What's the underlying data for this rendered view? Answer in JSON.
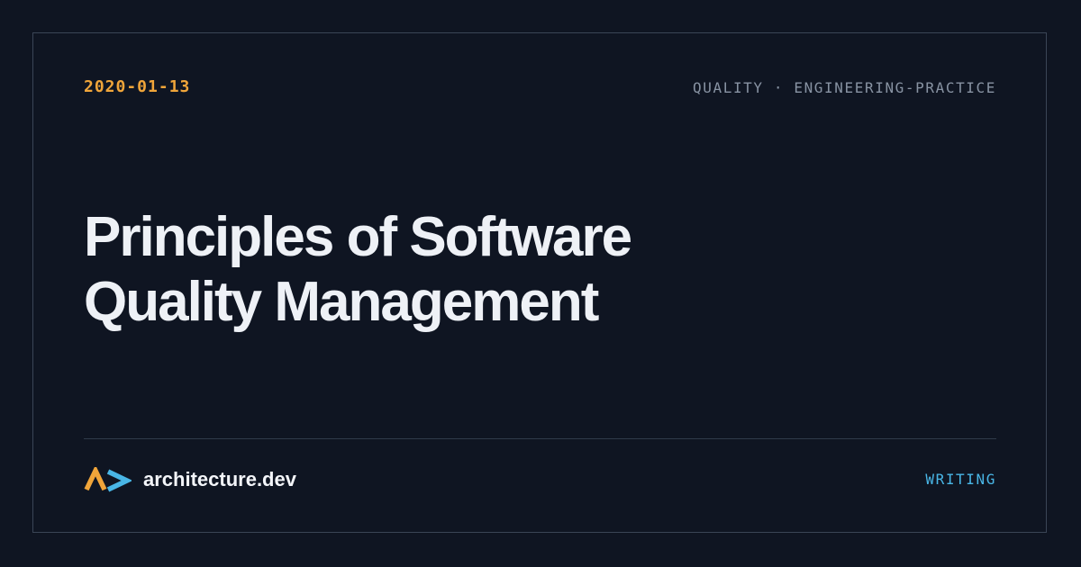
{
  "post": {
    "date": "2020-01-13",
    "tags": "QUALITY · ENGINEERING-PRACTICE",
    "title_line1": "Principles of Software",
    "title_line2": "Quality Management"
  },
  "footer": {
    "brand_name": "architecture.dev",
    "section": "WRITING",
    "logo_icon": "architecture-logo-icon"
  },
  "colors": {
    "background": "#0f1522",
    "accent_orange": "#f0a53a",
    "accent_blue": "#49b6e6",
    "muted_text": "#8893a3",
    "title_text": "#eef1f6"
  }
}
